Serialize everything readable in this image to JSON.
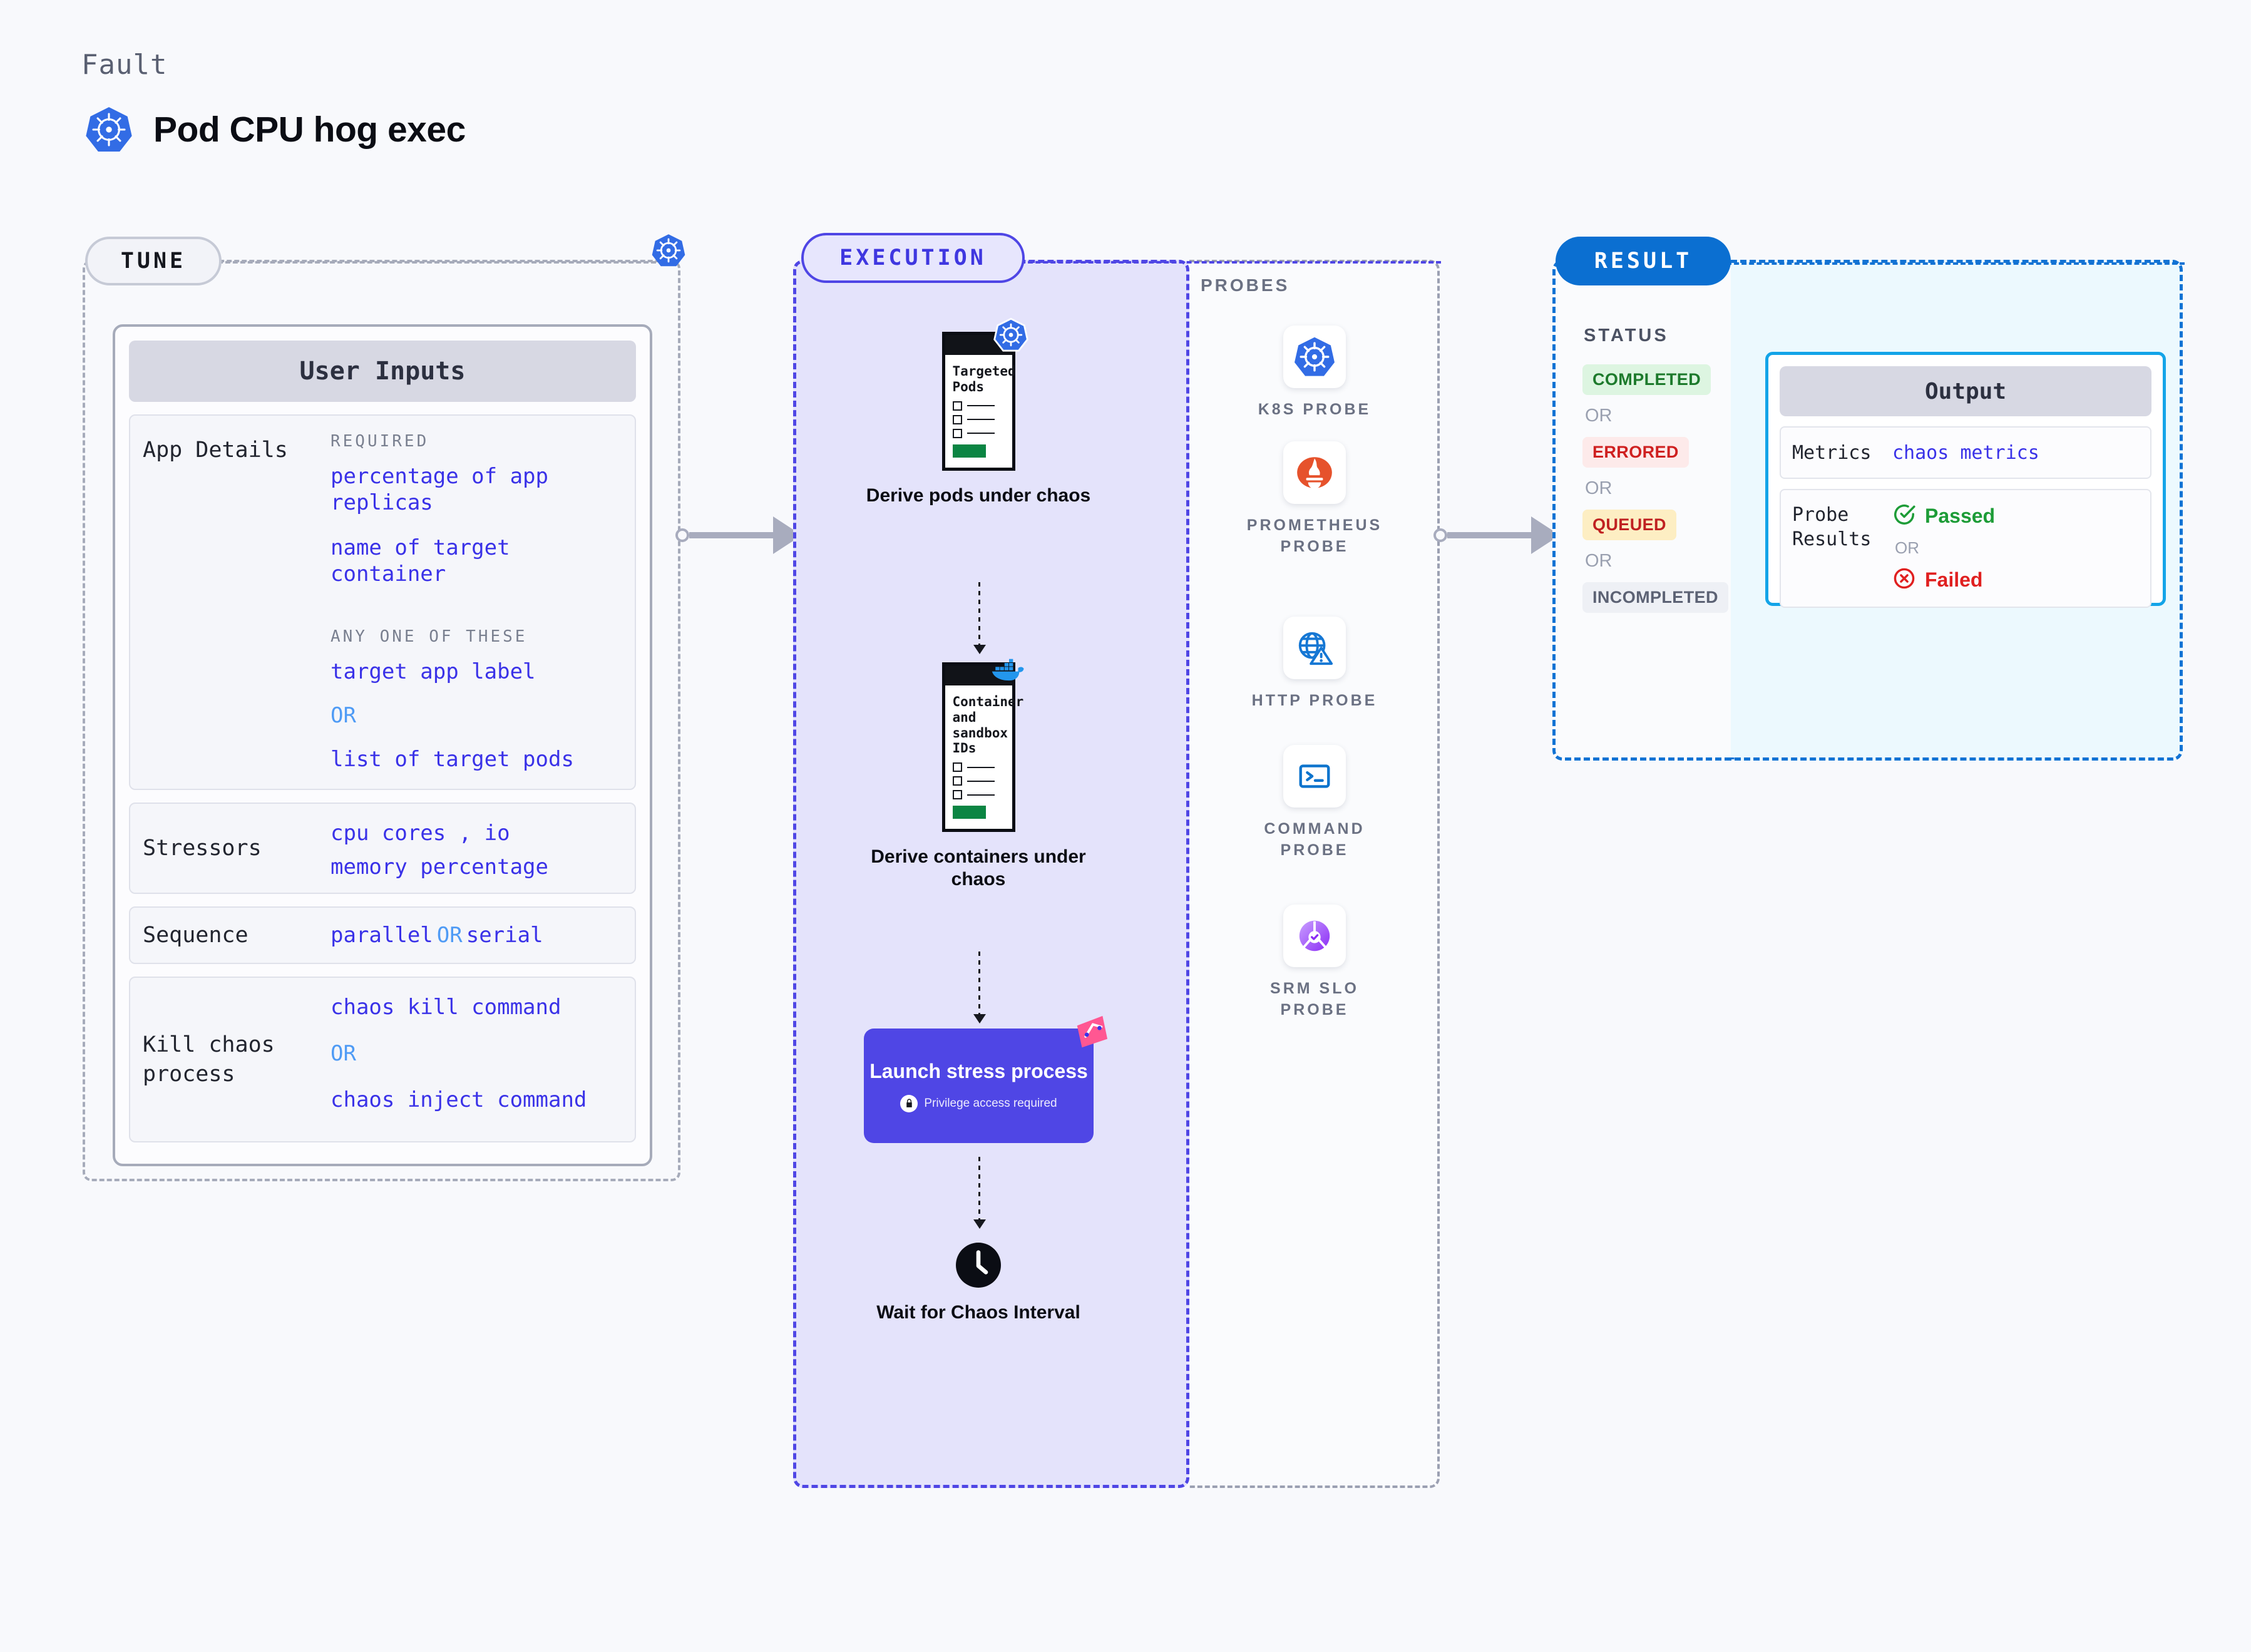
{
  "header": {
    "eyebrow": "Fault",
    "title": "Pod CPU hog exec",
    "icon": "kubernetes-icon"
  },
  "tune": {
    "label": "TUNE",
    "card_title": "User Inputs",
    "rows": [
      {
        "label": "App Details",
        "groups": [
          {
            "heading": "REQUIRED",
            "values": [
              "percentage of app replicas",
              "name of target container"
            ]
          },
          {
            "heading": "ANY ONE OF THESE",
            "values": [
              "target app label",
              "OR",
              "list of target pods"
            ]
          }
        ]
      },
      {
        "label": "Stressors",
        "values": [
          "cpu cores  , io",
          "memory percentage"
        ]
      },
      {
        "label": "Sequence",
        "value_prefix": "parallel ",
        "value_or": "OR",
        "value_suffix": " serial"
      },
      {
        "label": "Kill chaos process",
        "values": [
          "chaos kill command",
          "OR",
          "chaos inject command"
        ]
      }
    ]
  },
  "execution": {
    "label": "EXECUTION",
    "nodes": [
      {
        "doc_title": "Targeted Pods",
        "caption": "Derive pods under chaos",
        "badge": "kubernetes-icon"
      },
      {
        "doc_title": "Container and sandbox IDs",
        "caption": "Derive containers under chaos",
        "badge": "docker-icon"
      }
    ],
    "stress": {
      "title": "Launch stress process",
      "note": "Privilege access required",
      "badge": "harness-icon"
    },
    "wait": {
      "caption": "Wait for Chaos Interval",
      "icon": "clock-icon"
    }
  },
  "probes": {
    "title": "PROBES",
    "items": [
      {
        "label": "K8S PROBE",
        "icon": "kubernetes-icon"
      },
      {
        "label": "PROMETHEUS PROBE",
        "icon": "prometheus-icon"
      },
      {
        "label": "HTTP PROBE",
        "icon": "globe-warning-icon"
      },
      {
        "label": "COMMAND PROBE",
        "icon": "terminal-icon"
      },
      {
        "label": "SRM SLO PROBE",
        "icon": "srm-slo-icon"
      }
    ]
  },
  "result": {
    "label": "RESULT",
    "status_title": "STATUS",
    "statuses": [
      "COMPLETED",
      "ERRORED",
      "QUEUED",
      "INCOMPLETED"
    ],
    "or_text": "OR",
    "output": {
      "title": "Output",
      "metrics_label": "Metrics",
      "metrics_value": "chaos metrics",
      "probe_label": "Probe Results",
      "passed": "Passed",
      "failed": "Failed",
      "or_text": "OR"
    }
  },
  "colors": {
    "accent_indigo": "#4f46e5",
    "accent_blue": "#0b6fd1",
    "accent_cyan": "#13a4e8",
    "code_blue": "#3a32e8",
    "pass_green": "#1d9c37",
    "fail_red": "#e02020"
  }
}
